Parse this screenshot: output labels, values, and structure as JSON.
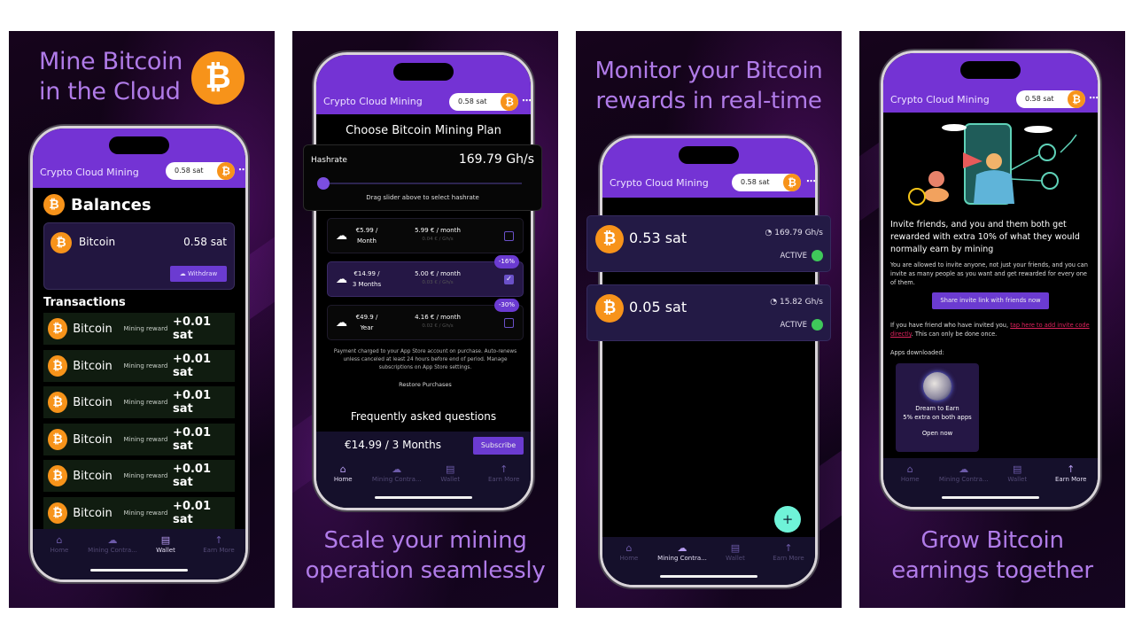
{
  "shared": {
    "app_title": "Crypto Cloud Mining",
    "sat_badge": "0.58 sat",
    "bitcoin_symbol": "₿",
    "more_icon": "⋯",
    "brand_color": "#7433d4",
    "bitcoin_color": "#f7931a",
    "nav": [
      {
        "label": "Home",
        "icon": "home-icon"
      },
      {
        "label": "Mining Contra...",
        "icon": "cloud-icon"
      },
      {
        "label": "Wallet",
        "icon": "wallet-icon"
      },
      {
        "label": "Earn More",
        "icon": "arrow-up-icon"
      }
    ]
  },
  "panels": [
    {
      "headline": [
        "Mine Bitcoin",
        "in the Cloud"
      ],
      "active_nav": 2,
      "balances": {
        "title": "Balances",
        "coin_name": "Bitcoin",
        "amount": "0.58 sat",
        "withdraw_label": "Withdraw"
      },
      "transactions": {
        "title": "Transactions",
        "items": [
          {
            "coin": "Bitcoin",
            "type": "Mining reward",
            "amount": "+0.01 sat"
          },
          {
            "coin": "Bitcoin",
            "type": "Mining reward",
            "amount": "+0.01 sat"
          },
          {
            "coin": "Bitcoin",
            "type": "Mining reward",
            "amount": "+0.01 sat"
          },
          {
            "coin": "Bitcoin",
            "type": "Mining reward",
            "amount": "+0.01 sat"
          },
          {
            "coin": "Bitcoin",
            "type": "Mining reward",
            "amount": "+0.01 sat"
          },
          {
            "coin": "Bitcoin",
            "type": "Mining reward",
            "amount": "+0.01 sat"
          }
        ]
      }
    },
    {
      "headline": [
        "Scale your mining",
        "operation seamlessly"
      ],
      "active_nav": 0,
      "plan_title": "Choose Bitcoin Mining Plan",
      "hashrate": {
        "label": "Hashrate",
        "value": "169.79 Gh/s",
        "hint": "Drag slider above to select hashrate",
        "slider_fraction": 0.0
      },
      "plans": [
        {
          "price_line1": "€5.99 /",
          "price_line2": "Month",
          "per_month": "5.99 € / month",
          "per_unit": "0.04 € / Gh/s",
          "selected": false,
          "discount": ""
        },
        {
          "price_line1": "€14.99 /",
          "price_line2": "3 Months",
          "per_month": "5.00 € / month",
          "per_unit": "0.03 € / Gh/s",
          "selected": true,
          "discount": "-16%"
        },
        {
          "price_line1": "€49.9 /",
          "price_line2": "Year",
          "per_month": "4.16 € / month",
          "per_unit": "0.02 € / Gh/s",
          "selected": false,
          "discount": "-30%"
        }
      ],
      "fine_print": "Payment charged to your App Store account on purchase. Auto-renews unless canceled at least 24 hours before end of period. Manage subscriptions on App Store settings.",
      "restore_label": "Restore Purchases",
      "faq_title": "Frequently asked questions",
      "selected_summary": "€14.99 / 3 Months",
      "subscribe_label": "Subscribe"
    },
    {
      "headline": [
        "Monitor your Bitcoin",
        "rewards in real-time"
      ],
      "active_nav": 1,
      "contracts": [
        {
          "amount": "0.53 sat",
          "hashrate": "169.79 Gh/s",
          "status": "ACTIVE"
        },
        {
          "amount": "0.05 sat",
          "hashrate": "15.82 Gh/s",
          "status": "ACTIVE"
        }
      ],
      "fab_label": "+",
      "status_color": "#3fc85a"
    },
    {
      "headline": [
        "Grow Bitcoin",
        "earnings together"
      ],
      "active_nav": 3,
      "invite_title": "Invite friends, and you and them both get rewarded with extra 10% of what they would normally earn by mining",
      "invite_body": "You are allowed to invite anyone, not just your friends, and you can invite as many people as you want and get rewarded for every one of them.",
      "share_label": "Share invite link with friends now",
      "code_prefix": "If you have friend who have invited you, ",
      "code_link": "tap here to add invite code directly",
      "code_suffix": ". This can only be done once.",
      "apps_label": "Apps downloaded:",
      "app_card": {
        "name": "Dream to Earn",
        "bonus": "5% extra on both apps",
        "open_label": "Open now"
      }
    }
  ]
}
